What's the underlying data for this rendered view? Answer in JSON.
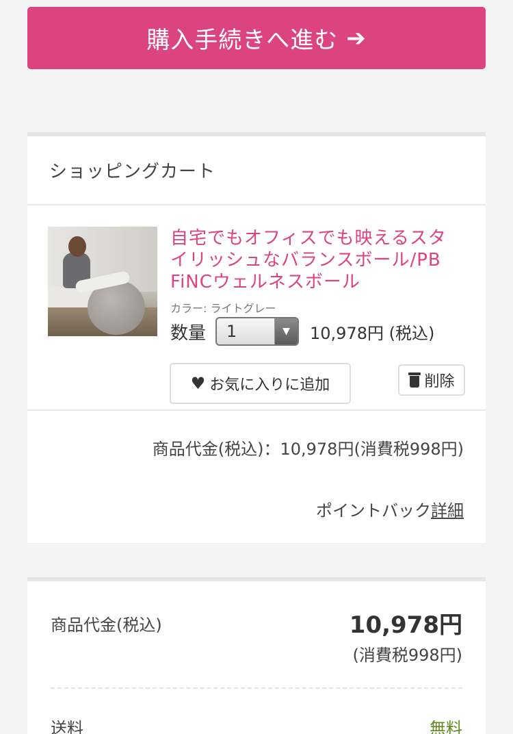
{
  "checkout": {
    "label": "購入手続きへ進む",
    "arrow": "➔"
  },
  "cart": {
    "title": "ショッピングカート",
    "item": {
      "image_alt": "balance-ball-photo",
      "title": "自宅でもオフィスでも映えるスタイリッシュなバランスボール/PB　FiNCウェルネスボール",
      "color": "カラー: ライトグレー",
      "qty_label": "数量",
      "qty_value": "1",
      "price": "10,978円 (税込)",
      "favorite_label": "お気に入りに追加",
      "delete_label": "削除"
    },
    "subtotal": "商品代金(税込)：10,978円(消費税998円)",
    "points_text": "ポイントバック",
    "points_link": "詳細"
  },
  "summary": {
    "items_label": "商品代金(税込)",
    "items_value": "10,978円",
    "items_tax": "(消費税998円)",
    "shipping_label": "送料",
    "shipping_value": "無料"
  },
  "colors": {
    "accent": "#dc4381",
    "free": "#5f8a22"
  }
}
